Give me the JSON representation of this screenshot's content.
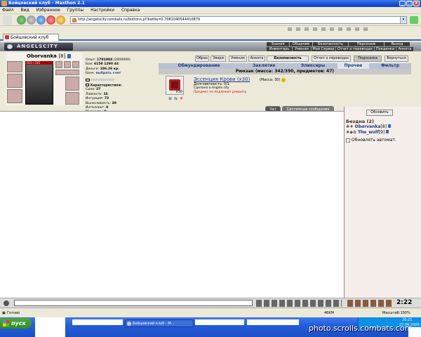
{
  "window": {
    "title": "Бойцовский клуб - Maxthon 2.1"
  },
  "menu": [
    "Файл",
    "Вид",
    "Избранное",
    "Группы",
    "Настройки",
    "Справка"
  ],
  "address": {
    "url": "http://angelscity.combats.ru/buttons.pl?battle=0.7081040544410879"
  },
  "browser_tab": {
    "label": "Бойцовский клуб"
  },
  "game_logo": "ANGELSCITY",
  "game_nav": {
    "row1": [
      "Знания",
      "Общение",
      "Безопасность",
      "Персонаж",
      "Выход"
    ],
    "row2": [
      "Инвентарь",
      "Умения",
      "Мой Сервер",
      "Отчет о переводах",
      "Поединки",
      "Анкета"
    ]
  },
  "character": {
    "name": "Oborvanka",
    "level": "[8]",
    "hp": "315 / 315",
    "stats": [
      {
        "label": "Опыт:",
        "value": "1781984",
        "extra": "(2000000)"
      },
      {
        "label": "Бои:",
        "value": "6158",
        "extra": "1290   44"
      },
      {
        "label": "Деньги:",
        "value": "186.26 кр."
      },
      {
        "label": "Банк:",
        "value": "выбрать счет"
      }
    ],
    "characteristics_label": "Характеристики:",
    "attributes": [
      {
        "label": "Сила:",
        "value": "27"
      },
      {
        "label": "Ловкость:",
        "value": "16"
      },
      {
        "label": "Интуиция:",
        "value": "73"
      },
      {
        "label": "Выносливость:",
        "value": "30"
      },
      {
        "label": "Интеллект:",
        "value": "0"
      },
      {
        "label": "Мудрость:",
        "value": "0"
      }
    ]
  },
  "top_buttons": [
    "Образ",
    "Звери",
    "Умения",
    "Анкета",
    "Безопасность",
    "Отчет о переводах",
    "Подсказка",
    "Вернуться"
  ],
  "inventory_tabs": [
    "Обмундирование",
    "Заклятия",
    "Эликсиры",
    "Прочее",
    "Фильтр"
  ],
  "rucksack_text": "Рюкзак (масса: 342/390, предметов: 47)",
  "item": {
    "name": "Эссенция Крови (x30)",
    "mass": "(Масса: 30)",
    "durability": "Долговечность: 0/1",
    "made_in": "Сделано в Angels city",
    "note": "Предмет не подлежит ремонту",
    "count": "x30"
  },
  "chat_tabs": [
    "Чат",
    "Системные сообщения"
  ],
  "right_pane": {
    "refresh_label": "Обновить",
    "location": "Бездна (2)",
    "players": [
      {
        "name": "Oborvanka",
        "level": "[8]"
      },
      {
        "name": "The_wolf",
        "level": "[9]"
      }
    ],
    "auto_refresh_label": "Обновлять автомат."
  },
  "clock": "2:22",
  "status": {
    "left": "Готово",
    "memory": "46KM",
    "zoom": "Масштаб:100%"
  },
  "taskbar": {
    "start": "пуск",
    "task": "Бойцовский клуб - M...",
    "time": "20:21",
    "date": "27.06.2009"
  },
  "watermark": "photo.scrolls.combats.com",
  "colors": {
    "accent": "#1b3a78",
    "link": "#1b3a9c",
    "hp": "#aa0000",
    "note": "#cc0000"
  }
}
